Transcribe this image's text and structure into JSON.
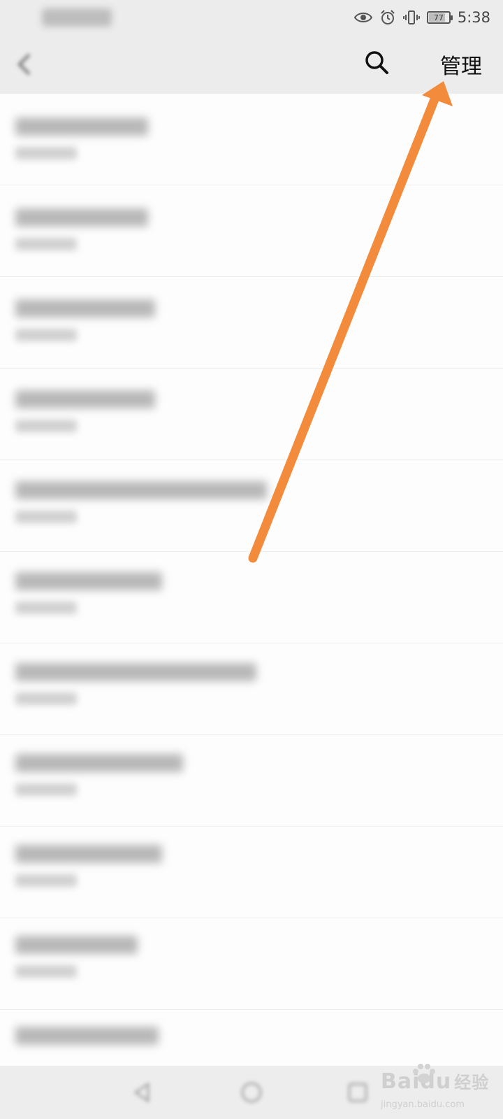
{
  "status_bar": {
    "carrier": "",
    "battery_level": "77",
    "time": "5:38"
  },
  "header": {
    "title": "",
    "search_icon": "search-icon",
    "manage_label": "管理"
  },
  "list": {
    "rows": [
      {
        "title": "",
        "subtitle": ""
      },
      {
        "title": "",
        "subtitle": ""
      },
      {
        "title": "",
        "subtitle": ""
      },
      {
        "title": "",
        "subtitle": ""
      },
      {
        "title": "",
        "subtitle": ""
      },
      {
        "title": "",
        "subtitle": ""
      },
      {
        "title": "",
        "subtitle": ""
      },
      {
        "title": "",
        "subtitle": ""
      },
      {
        "title": "",
        "subtitle": ""
      },
      {
        "title": "",
        "subtitle": ""
      },
      {
        "title": "",
        "subtitle": ""
      }
    ]
  },
  "watermark": {
    "brand": "Baidu",
    "suffix": "经验",
    "url": "jingyan.baidu.com"
  },
  "colors": {
    "annotation_arrow": "#f38b3c",
    "header_bg": "#ececec",
    "list_bg": "#fdfdfd"
  }
}
